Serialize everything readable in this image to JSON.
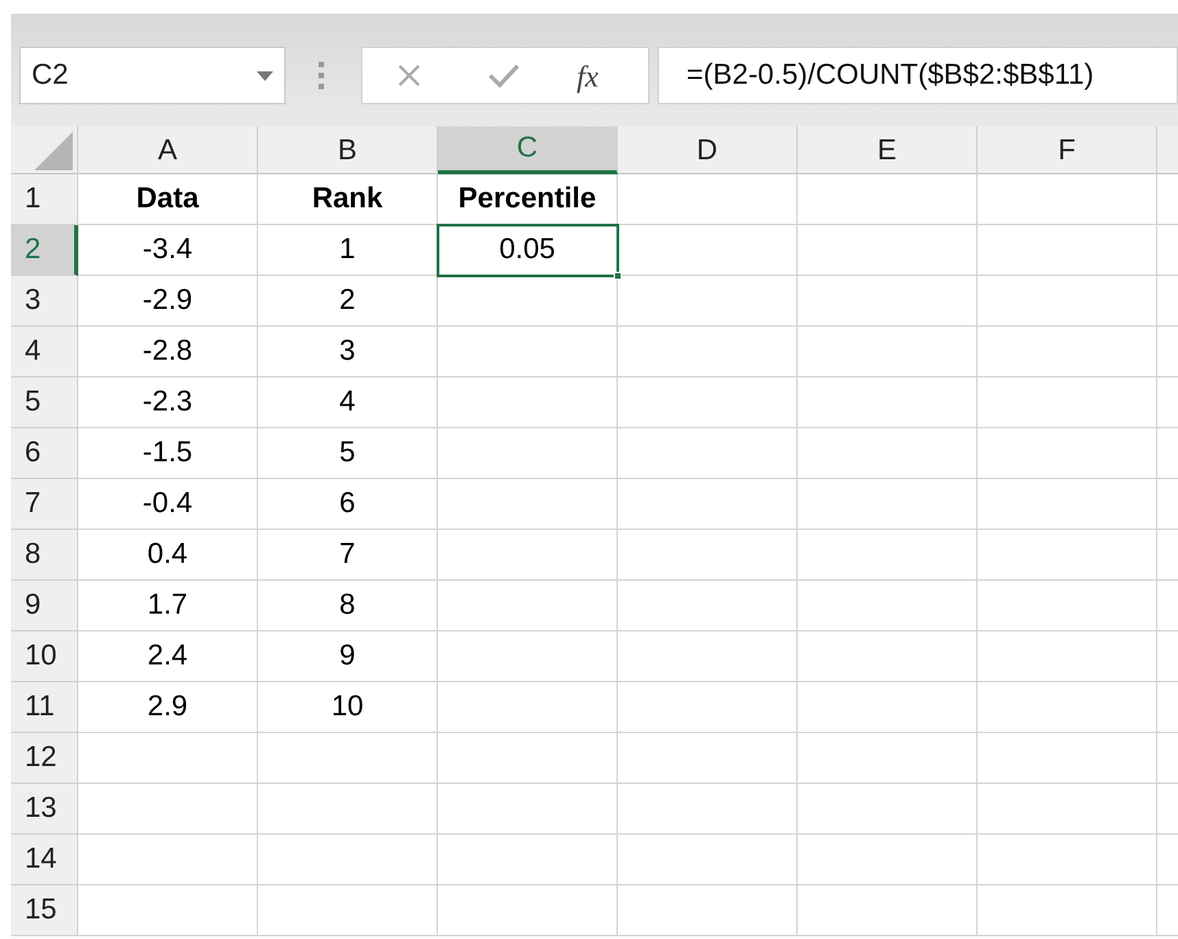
{
  "name_box": "C2",
  "fx_label": "fx",
  "formula": "=(B2-0.5)/COUNT($B$2:$B$11)",
  "columns": [
    {
      "label": "A",
      "selected": false
    },
    {
      "label": "B",
      "selected": false
    },
    {
      "label": "C",
      "selected": true
    },
    {
      "label": "D",
      "selected": false
    },
    {
      "label": "E",
      "selected": false
    },
    {
      "label": "F",
      "selected": false
    }
  ],
  "rows": [
    {
      "label": "1",
      "selected": false,
      "kind": "header",
      "cells": [
        {
          "text": "Data",
          "selected": false
        },
        {
          "text": "Rank",
          "selected": false
        },
        {
          "text": "Percentile",
          "selected": false
        }
      ]
    },
    {
      "label": "2",
      "selected": true,
      "kind": "data",
      "cells": [
        {
          "text": "-3.4",
          "selected": false
        },
        {
          "text": "1",
          "selected": false
        },
        {
          "text": "0.05",
          "selected": true
        }
      ]
    },
    {
      "label": "3",
      "selected": false,
      "kind": "data",
      "cells": [
        {
          "text": "-2.9",
          "selected": false
        },
        {
          "text": "2",
          "selected": false
        }
      ]
    },
    {
      "label": "4",
      "selected": false,
      "kind": "data",
      "cells": [
        {
          "text": "-2.8",
          "selected": false
        },
        {
          "text": "3",
          "selected": false
        }
      ]
    },
    {
      "label": "5",
      "selected": false,
      "kind": "data",
      "cells": [
        {
          "text": "-2.3",
          "selected": false
        },
        {
          "text": "4",
          "selected": false
        }
      ]
    },
    {
      "label": "6",
      "selected": false,
      "kind": "data",
      "cells": [
        {
          "text": "-1.5",
          "selected": false
        },
        {
          "text": "5",
          "selected": false
        }
      ]
    },
    {
      "label": "7",
      "selected": false,
      "kind": "data",
      "cells": [
        {
          "text": "-0.4",
          "selected": false
        },
        {
          "text": "6",
          "selected": false
        }
      ]
    },
    {
      "label": "8",
      "selected": false,
      "kind": "data",
      "cells": [
        {
          "text": "0.4",
          "selected": false
        },
        {
          "text": "7",
          "selected": false
        }
      ]
    },
    {
      "label": "9",
      "selected": false,
      "kind": "data",
      "cells": [
        {
          "text": "1.7",
          "selected": false
        },
        {
          "text": "8",
          "selected": false
        }
      ]
    },
    {
      "label": "10",
      "selected": false,
      "kind": "data",
      "cells": [
        {
          "text": "2.4",
          "selected": false
        },
        {
          "text": "9",
          "selected": false
        }
      ]
    },
    {
      "label": "11",
      "selected": false,
      "kind": "data",
      "cells": [
        {
          "text": "2.9",
          "selected": false
        },
        {
          "text": "10",
          "selected": false
        }
      ]
    },
    {
      "label": "12",
      "selected": false,
      "kind": "data",
      "cells": []
    },
    {
      "label": "13",
      "selected": false,
      "kind": "data",
      "cells": []
    },
    {
      "label": "14",
      "selected": false,
      "kind": "data",
      "cells": []
    },
    {
      "label": "15",
      "selected": false,
      "kind": "data",
      "cells": []
    }
  ]
}
